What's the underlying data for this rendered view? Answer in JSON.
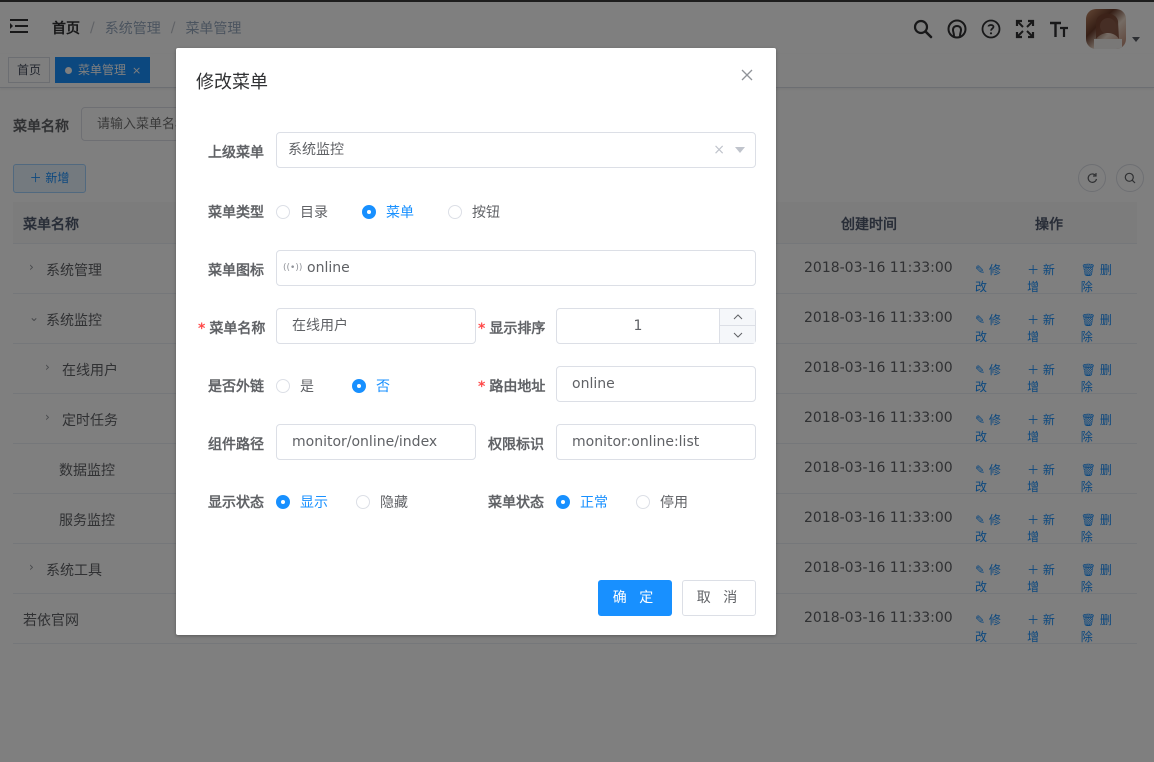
{
  "breadcrumb": [
    "首页",
    "系统管理",
    "菜单管理"
  ],
  "nav_icons": [
    "search-icon",
    "github-icon",
    "question-icon",
    "fullscreen-icon",
    "font-size-icon"
  ],
  "tags": [
    {
      "label": "首页",
      "close": ""
    },
    {
      "label": "菜单管理",
      "close": "×"
    }
  ],
  "search": {
    "label": "菜单名称",
    "placeholder": "请输入菜单名称"
  },
  "toolbar": {
    "add_label": "＋ 新增"
  },
  "table": {
    "headers": {
      "name": "菜单名称",
      "created": "创建时间",
      "ops": "操作"
    },
    "op_labels": {
      "edit": "修改",
      "add": "新增",
      "delete": "删除"
    },
    "rows": [
      {
        "name": "系统管理",
        "caret": "›",
        "time": "2018-03-16 11:33:00"
      },
      {
        "name": "系统监控",
        "caret": "⌄",
        "time": "2018-03-16 11:33:00"
      },
      {
        "name": "在线用户",
        "caret": "›",
        "time": "2018-03-16 11:33:00"
      },
      {
        "name": "定时任务",
        "caret": "›",
        "time": "2018-03-16 11:33:00"
      },
      {
        "name": "数据监控",
        "caret": "",
        "time": "2018-03-16 11:33:00"
      },
      {
        "name": "服务监控",
        "caret": "",
        "time": "2018-03-16 11:33:00"
      },
      {
        "name": "系统工具",
        "caret": "›",
        "time": "2018-03-16 11:33:00"
      },
      {
        "name": "若依官网",
        "caret": "",
        "time": "2018-03-16 11:33:00"
      }
    ]
  },
  "dialog": {
    "title": "修改菜单",
    "parent_label": "上级菜单",
    "parent_value": "系统监控",
    "type_label": "菜单类型",
    "type_options": [
      "目录",
      "菜单",
      "按钮"
    ],
    "type_selected": "菜单",
    "icon_label": "菜单图标",
    "icon_value": "online",
    "name_label": "菜单名称",
    "name_value": "在线用户",
    "order_label": "显示排序",
    "order_value": "1",
    "external_label": "是否外链",
    "external_options": [
      "是",
      "否"
    ],
    "external_selected": "否",
    "route_label": "路由地址",
    "route_value": "online",
    "component_label": "组件路径",
    "component_value": "monitor/online/index",
    "perm_label": "权限标识",
    "perm_value": "monitor:online:list",
    "visible_label": "显示状态",
    "visible_options": [
      "显示",
      "隐藏"
    ],
    "visible_selected": "显示",
    "status_label": "菜单状态",
    "status_options": [
      "正常",
      "停用"
    ],
    "status_selected": "正常",
    "confirm_label": "确 定",
    "cancel_label": "取 消"
  },
  "colors": {
    "primary": "#1890ff",
    "required": "#ff4949"
  }
}
